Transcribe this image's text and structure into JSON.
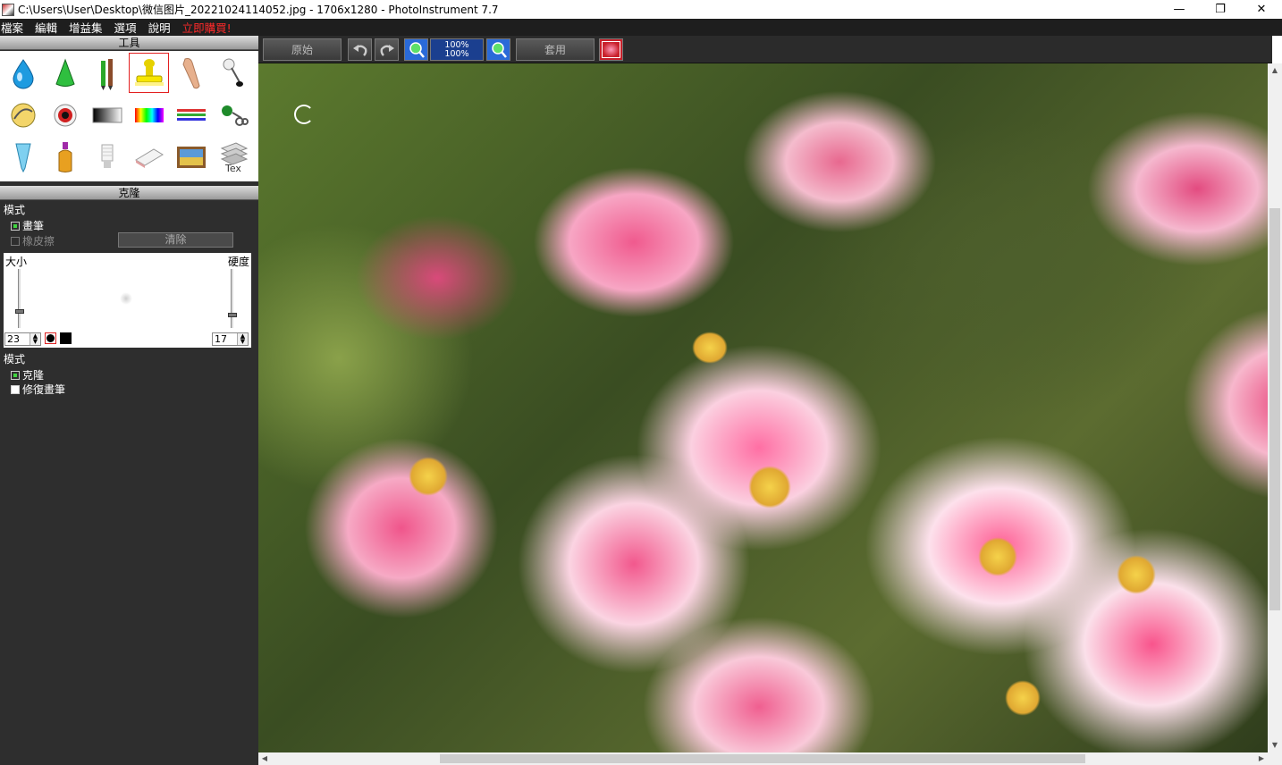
{
  "window": {
    "title": "C:\\Users\\User\\Desktop\\微信图片_20221024114052.jpg - 1706x1280 - PhotoInstrument 7.7",
    "minimize_icon": "minimize-icon",
    "restore_icon": "restore-icon",
    "close_icon": "close-icon"
  },
  "menu": {
    "items": [
      "檔案",
      "編輯",
      "增益集",
      "選項",
      "說明"
    ],
    "promo": "立即購買!"
  },
  "tools_panel": {
    "header": "工具",
    "selected_tool": "clone-stamp",
    "tools": [
      "drop-icon",
      "cone-icon",
      "pencils-icon",
      "stamp-icon",
      "finger-icon",
      "pin-icon",
      "warp-icon",
      "eye-icon",
      "gradient-icon",
      "spectrum-icon",
      "lines-icon",
      "scissors-icon",
      "tube-icon",
      "bottle-icon",
      "bulb-icon",
      "eraser-icon",
      "picture-icon",
      "text-icon"
    ]
  },
  "clone_panel": {
    "header": "克隆",
    "mode_label": "模式",
    "brush_label": "畫筆",
    "eraser_label": "橡皮擦",
    "clear_label": "清除",
    "size_label": "大小",
    "hardness_label": "硬度",
    "size_value": "23",
    "hardness_value": "17",
    "size_level": 0.23,
    "hardness_level": 0.17,
    "mode2_label": "模式",
    "clone_option": "克隆",
    "repair_option": "修復畫筆"
  },
  "toolbar": {
    "original_label": "原始",
    "apply_label": "套用",
    "zoom_top": "100%",
    "zoom_bottom": "100%",
    "undo_icon": "undo-icon",
    "redo_icon": "redo-icon",
    "zoom_in_icon": "zoom-in-icon",
    "zoom_out_icon": "zoom-out-icon",
    "thumbnail_icon": "thumbnail-icon"
  },
  "colors": {
    "panel_bg": "#2e2e2e",
    "promo": "#ff2a2a",
    "selected_outline": "#e32020",
    "check_on": "#3fd63f"
  }
}
